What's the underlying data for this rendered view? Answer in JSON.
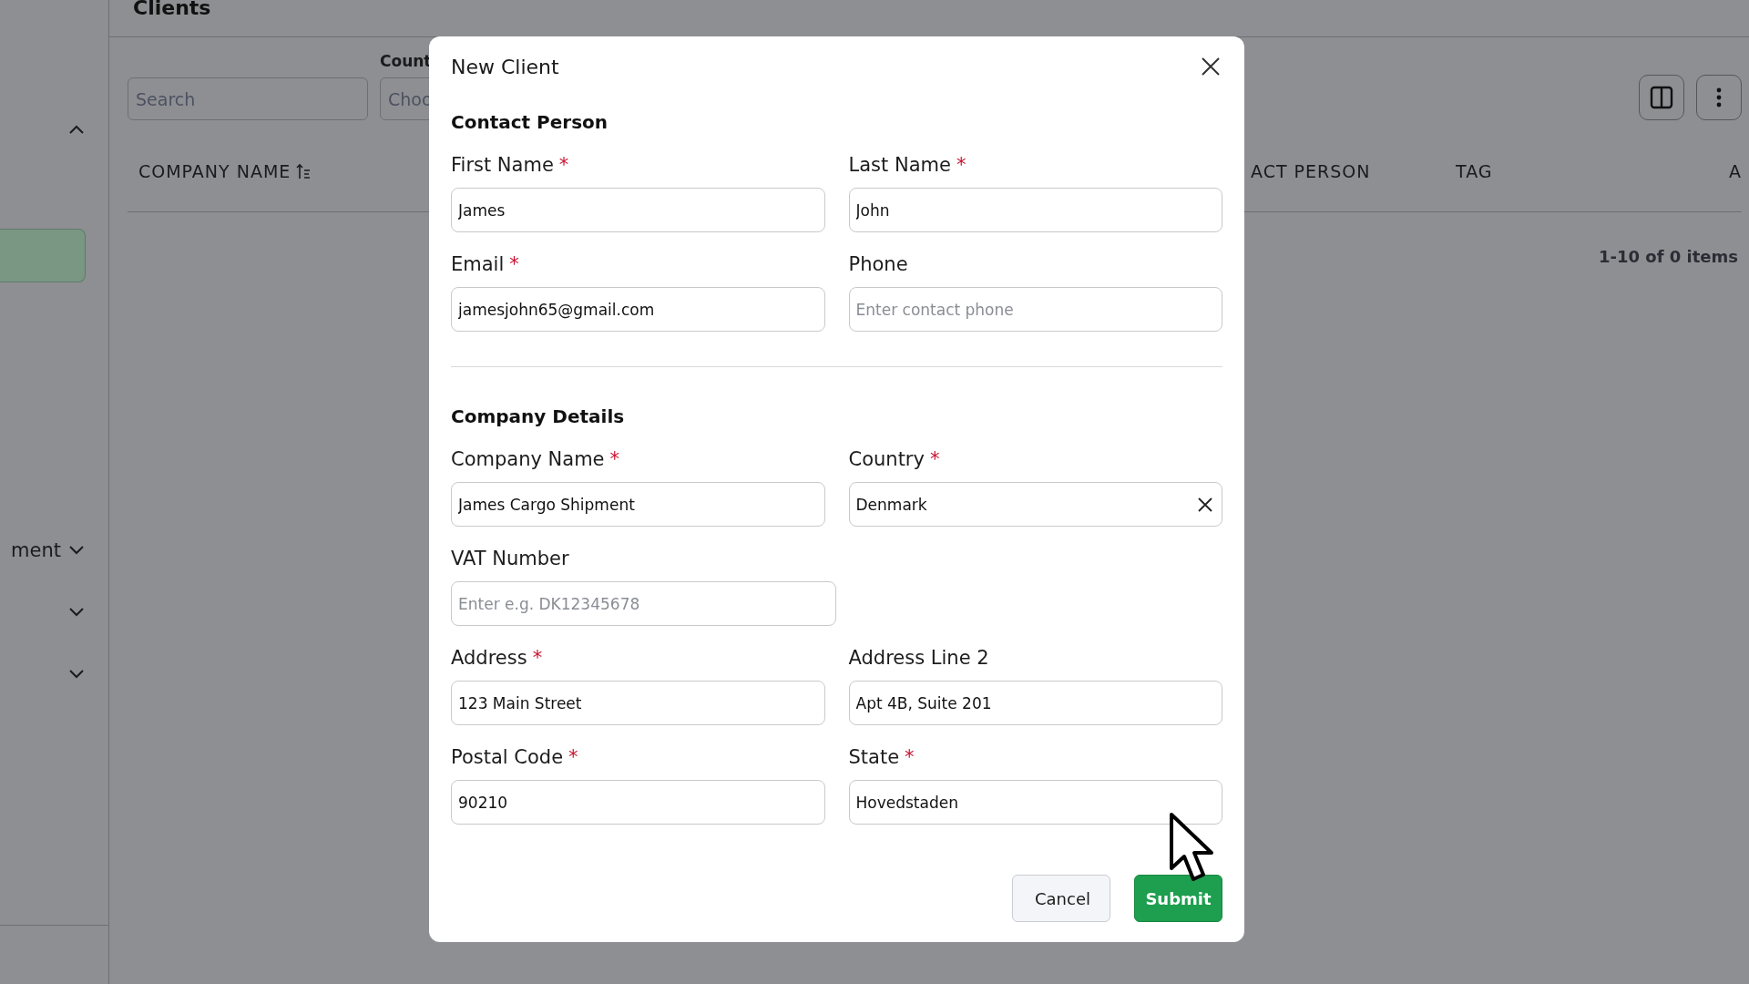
{
  "sidebar": {
    "items": [
      {
        "kind": "group",
        "expanded": true
      },
      {
        "kind": "link",
        "selected": true
      },
      {
        "kind": "group",
        "label": "ment",
        "expanded": false
      },
      {
        "kind": "group",
        "expanded": false
      },
      {
        "kind": "group",
        "expanded": false
      }
    ]
  },
  "page": {
    "title": "Clients"
  },
  "filters": {
    "search": {
      "placeholder": "Search"
    },
    "country": {
      "label": "Count",
      "placeholder": "Choo"
    }
  },
  "table": {
    "columns": [
      {
        "label": "COMPANY NAME",
        "sorted": true
      },
      {
        "label": "ACT PERSON",
        "sorted": false
      },
      {
        "label": "TAG",
        "sorted": false
      },
      {
        "label": "A",
        "sorted": false
      }
    ],
    "pagination": "1-10 of 0 items"
  },
  "dialog": {
    "title": "New Client",
    "sections": [
      {
        "title": "Contact Person",
        "rows": [
          [
            {
              "label": "First Name",
              "required_mark": "*",
              "kind": "text",
              "value": "James"
            },
            {
              "label": "Last Name",
              "required_mark": "*",
              "kind": "text",
              "value": "John"
            }
          ],
          [
            {
              "label": "Email",
              "required_mark": "*",
              "kind": "text",
              "value": "jamesjohn65@gmail.com"
            },
            {
              "label": "Phone",
              "kind": "text",
              "placeholder": "Enter contact phone"
            }
          ]
        ]
      },
      {
        "title": "Company Details",
        "rows": [
          [
            {
              "label": "Company Name",
              "required_mark": "*",
              "kind": "text",
              "value": "James Cargo Shipment"
            },
            {
              "label": "Country",
              "required_mark": "*",
              "kind": "select",
              "value": "Denmark"
            }
          ],
          [
            {
              "label": "VAT Number",
              "kind": "text",
              "placeholder": "Enter e.g. DK12345678"
            }
          ],
          [
            {
              "label": "Address",
              "required_mark": "*",
              "kind": "text",
              "value": "123 Main Street"
            },
            {
              "label": "Address Line 2",
              "kind": "text",
              "value": "Apt 4B, Suite 201"
            }
          ],
          [
            {
              "label": "Postal Code",
              "required_mark": "*",
              "kind": "text",
              "value": "90210"
            },
            {
              "label": "State",
              "required_mark": "*",
              "kind": "text",
              "value": "Hovedstaden"
            }
          ]
        ]
      }
    ],
    "buttons": [
      {
        "label": "Cancel",
        "kind": "secondary"
      },
      {
        "label": "Submit",
        "kind": "primary"
      }
    ]
  }
}
